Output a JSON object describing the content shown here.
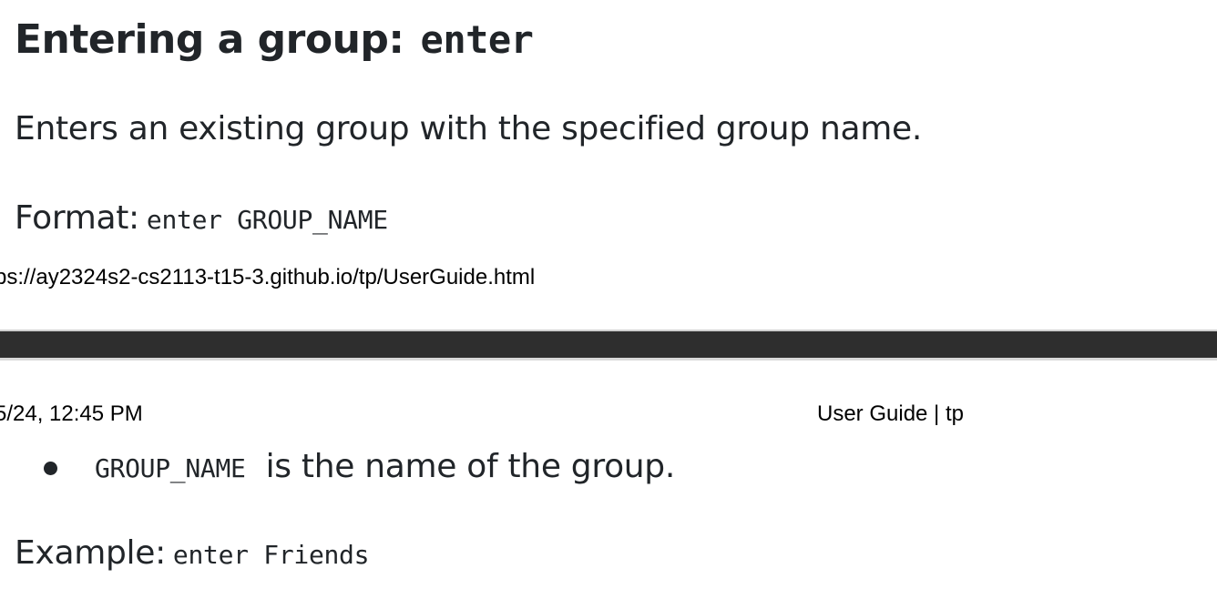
{
  "section": {
    "heading_text": "Entering a group:",
    "heading_command": "enter",
    "description": "Enters an existing group with the specified group name.",
    "format_label": "Format:",
    "format_value": "enter GROUP_NAME",
    "bullets": [
      {
        "code": "GROUP_NAME",
        "text": "is the name of the group."
      }
    ],
    "example_label": "Example:",
    "example_value": "enter Friends"
  },
  "print_footer": {
    "url": "ps://ay2324s2-cs2113-t15-3.github.io/tp/UserGuide.html"
  },
  "print_header": {
    "datetime": "5/24, 12:45 PM",
    "title": "User Guide | tp"
  }
}
